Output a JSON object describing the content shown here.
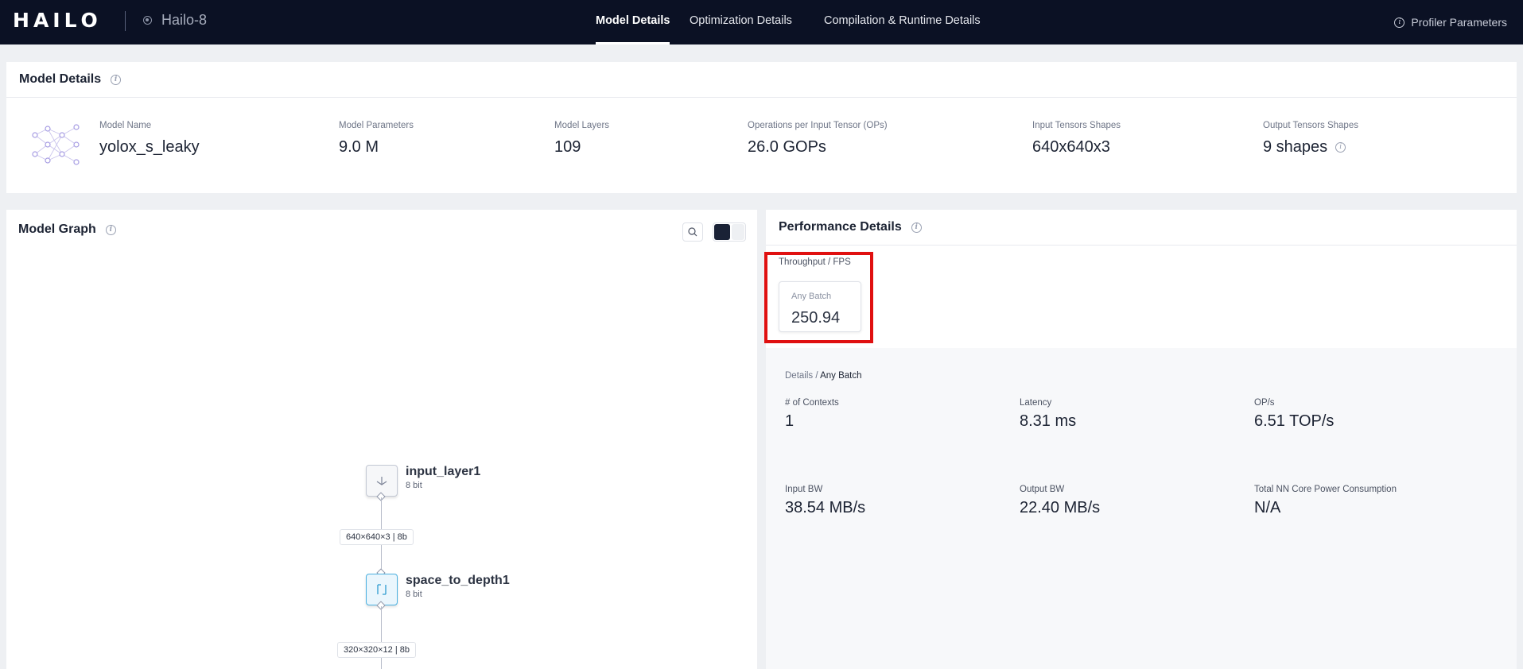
{
  "nav": {
    "logo_letters": [
      "H",
      "A",
      "I",
      "L",
      "O"
    ],
    "device": "Hailo-8",
    "tabs": [
      {
        "label": "Model Details",
        "active": true
      },
      {
        "label": "Optimization Details",
        "active": false
      },
      {
        "label": "Compilation & Runtime Details",
        "active": false
      }
    ],
    "profiler_label": "Profiler Parameters"
  },
  "model_details": {
    "title": "Model Details",
    "stats": [
      {
        "label": "Model Name",
        "value": "yolox_s_leaky"
      },
      {
        "label": "Model Parameters",
        "value": "9.0 M"
      },
      {
        "label": "Model Layers",
        "value": "109"
      },
      {
        "label": "Operations per Input Tensor (OPs)",
        "value": "26.0 GOPs"
      },
      {
        "label": "Input Tensors Shapes",
        "value": "640x640x3"
      },
      {
        "label": "Output Tensors Shapes",
        "value": "9 shapes"
      }
    ]
  },
  "model_graph": {
    "title": "Model Graph",
    "nodes": [
      {
        "name": "input_layer1",
        "bits": "8 bit"
      },
      {
        "name": "space_to_depth1",
        "bits": "8 bit"
      }
    ],
    "edges": [
      {
        "label": "640×640×3 | 8b"
      },
      {
        "label": "320×320×12 | 8b"
      }
    ]
  },
  "performance": {
    "title": "Performance Details",
    "throughput_label": "Throughput / FPS",
    "batch": {
      "label": "Any Batch",
      "value": "250.94"
    },
    "breadcrumb": {
      "prefix": "Details / ",
      "current": "Any Batch"
    },
    "metrics": [
      {
        "label": "# of Contexts",
        "value": "1"
      },
      {
        "label": "Latency",
        "value": "8.31 ms"
      },
      {
        "label": "OP/s",
        "value": "6.51 TOP/s"
      },
      {
        "label": "Input BW",
        "value": "38.54 MB/s"
      },
      {
        "label": "Output BW",
        "value": "22.40 MB/s"
      },
      {
        "label": "Total NN Core Power Consumption",
        "value": "N/A"
      }
    ]
  },
  "colors": {
    "nav_bg": "#0b1124",
    "highlight": "#e01010",
    "node_accent": "#4ab0e0"
  }
}
